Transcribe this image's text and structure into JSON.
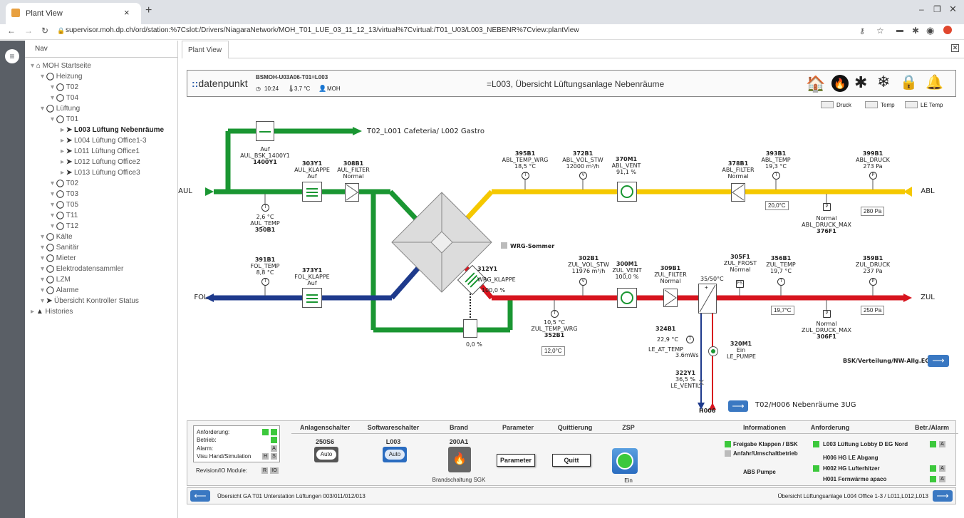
{
  "browser": {
    "tab_title": "Plant View",
    "url": "supervisor.moh.dp.ch/ord/station:%7Cslot:/Drivers/NiagaraNetwork/MOH_T01_LUE_03_11_12_13/virtual%7Cvirtual:/T01_U03/L003_NEBENR%7Cview:plantView"
  },
  "nav": {
    "title": "Nav",
    "items": [
      {
        "label": "MOH Startseite",
        "lvl": 0,
        "icon": "home"
      },
      {
        "label": "Heizung",
        "lvl": 1,
        "icon": "circle"
      },
      {
        "label": "T02",
        "lvl": 2,
        "icon": "circle"
      },
      {
        "label": "T04",
        "lvl": 2,
        "icon": "circle"
      },
      {
        "label": "Lüftung",
        "lvl": 1,
        "icon": "circle"
      },
      {
        "label": "T01",
        "lvl": 2,
        "icon": "circle"
      },
      {
        "label": "L003 Lüftung Nebenräume",
        "lvl": 3,
        "icon": "arrow",
        "sel": true
      },
      {
        "label": "L004 Lüftung Office1-3",
        "lvl": 3,
        "icon": "arrow"
      },
      {
        "label": "L011 Lüftung Office1",
        "lvl": 3,
        "icon": "arrow"
      },
      {
        "label": "L012 Lüftung Office2",
        "lvl": 3,
        "icon": "arrow"
      },
      {
        "label": "L013 Lüftung Office3",
        "lvl": 3,
        "icon": "arrow"
      },
      {
        "label": "T02",
        "lvl": 2,
        "icon": "circle"
      },
      {
        "label": "T03",
        "lvl": 2,
        "icon": "circle"
      },
      {
        "label": "T05",
        "lvl": 2,
        "icon": "circle"
      },
      {
        "label": "T11",
        "lvl": 2,
        "icon": "circle"
      },
      {
        "label": "T12",
        "lvl": 2,
        "icon": "circle"
      },
      {
        "label": "Kälte",
        "lvl": 1,
        "icon": "circle"
      },
      {
        "label": "Sanitär",
        "lvl": 1,
        "icon": "circle"
      },
      {
        "label": "Mieter",
        "lvl": 1,
        "icon": "circle"
      },
      {
        "label": "Elektrodatensammler",
        "lvl": 1,
        "icon": "circle"
      },
      {
        "label": "LZM",
        "lvl": 1,
        "icon": "circle"
      },
      {
        "label": "Alarme",
        "lvl": 1,
        "icon": "circle"
      },
      {
        "label": "Übersicht Kontroller Status",
        "lvl": 1,
        "icon": "arrow"
      },
      {
        "label": "Histories",
        "lvl": 0,
        "icon": "warn"
      }
    ]
  },
  "pv": {
    "tab": "Plant View"
  },
  "header": {
    "logo": "datenpunkt",
    "id": "BSMOH-U03A06-T01=L003",
    "time": "10:24",
    "temp": "3,7 °C",
    "user": "MOH",
    "title": "=L003, Übersicht Lüftungsanlage Nebenräume"
  },
  "legend": {
    "druck": "Druck",
    "temp": "Temp",
    "letemp": "LE Temp"
  },
  "plant": {
    "aul": "AUL",
    "abl": "ABL",
    "fol": "FOL",
    "zul": "ZUL",
    "cafeteria": "T02_L001 Cafeteria/ L002 Gastro",
    "bsk_auf": "Auf",
    "bsk_code": "AUL_BSK_1400Y1",
    "bsk_id": "1400Y1",
    "y303_id": "303Y1",
    "y303_name": "AUL_KLAPPE",
    "y303_state": "Auf",
    "b308_id": "308B1",
    "b308_name": "AUL_FILTER",
    "b308_state": "Normal",
    "b350_val": "2,6 °C",
    "b350_name": "AUL_TEMP",
    "b350_id": "350B1",
    "b395_id": "395B1",
    "b395_name": "ABL_TEMP_WRG",
    "b395_val": "18,5 °C",
    "b372_id": "372B1",
    "b372_name": "ABL_VOL_STW",
    "b372_val": "12000 m³/h",
    "m370_id": "370M1",
    "m370_name": "ABL_VENT",
    "m370_val": "91,1 %",
    "b378_id": "378B1",
    "b378_name": "ABL_FILTER",
    "b378_state": "Normal",
    "b393_id": "393B1",
    "b393_name": "ABL_TEMP",
    "b393_val": "19,3 °C",
    "b393_box": "20,0°C",
    "b399_id": "399B1",
    "b399_name": "ABL_DRUCK",
    "b399_val": "273 Pa",
    "b399_box": "280 Pa",
    "f376_state": "Normal",
    "f376_name": "ABL_DRUCK_MAX",
    "f376_id": "376F1",
    "wrg_sommer": "WRG-Sommer",
    "b391_id": "391B1",
    "b391_name": "FOL_TEMP",
    "b391_val": "8,8 °C",
    "y373_id": "373Y1",
    "y373_name": "FOL_KLAPPE",
    "y373_state": "Auf",
    "y312_id": "312Y1",
    "y312_name": "WRG_KLAPPE",
    "y312_val": "100,0 %",
    "bypass_val": "0,0 %",
    "b302_id": "302B1",
    "b302_name": "ZUL_VOL_STW",
    "b302_val": "11976 m³/h",
    "m300_id": "300M1",
    "m300_name": "ZUL_VENT",
    "m300_val": "100,0 %",
    "b309_id": "309B1",
    "b309_name": "ZUL_FILTER",
    "b309_state": "Normal",
    "f305_id": "305F1",
    "f305_name": "ZUL_FROST",
    "f305_state": "Normal",
    "b356_id": "356B1",
    "b356_name": "ZUL_TEMP",
    "b356_val": "19,7 °C",
    "b356_box": "19,7°C",
    "b359_id": "359B1",
    "b359_name": "ZUL_DRUCK",
    "b359_val": "237 Pa",
    "b359_box": "250 Pa",
    "f306_state": "Normal",
    "f306_name": "ZUL_DRUCK_MAX",
    "f306_id": "306F1",
    "b352_val": "10,5 °C",
    "b352_name": "ZUL_TEMP_WRG",
    "b352_id": "352B1",
    "b352_box": "12,0°C",
    "coil_label": "35/50°C",
    "b324_id": "324B1",
    "b324_val": "22,9 °C",
    "b324_name": "LE_AT_TEMP",
    "b324_pres": "3.6mWs",
    "m320_id": "320M1",
    "m320_state": "Ein",
    "m320_name": "LE_PUMPE",
    "y322_id": "322Y1",
    "y322_val": "36,5 %",
    "y322_name": "LE_VENTIL",
    "h006": "H006",
    "h006_link": "T02/H006 Nebenräume 3UG",
    "bsk_link": "BSK/Verteilung/NW-Allg.EG."
  },
  "status": {
    "anf": "Anforderung:",
    "betrieb": "Betrieb:",
    "alarm": "Alarm:",
    "visu": "Visu Hand/Simulation",
    "rev": "Revision/IO Module:",
    "a": "A",
    "h": "H",
    "s": "S",
    "r": "R",
    "io": "IO"
  },
  "cols": {
    "anlagen": "Anlagenschalter",
    "software": "Softwareschalter",
    "brand": "Brand",
    "param": "Parameter",
    "quitt": "Quittierung",
    "zsp": "ZSP",
    "info": "Informationen",
    "anford": "Anforderung",
    "betr": "Betr./Alarm"
  },
  "ctrl": {
    "s1_id": "250S6",
    "s1_btn": "Auto",
    "s2_id": "L003",
    "s2_btn": "Auto",
    "brand_id": "200A1",
    "brand_txt": "Brandschaltung SGK",
    "param_btn": "Parameter",
    "quitt_btn": "Quitt",
    "zsp_state": "Ein"
  },
  "info": {
    "i1": "Freigabe Klappen / BSK",
    "i2": "Anfahr/Umschaltbetrieb",
    "i3": "ABS Pumpe"
  },
  "anf": {
    "a1": "L003 Lüftung Lobby D EG Nord",
    "a2": "H006 HG LE Abgang",
    "a3": "H002 HG Lufterhitzer",
    "a4": "H001 Fernwärme apaco"
  },
  "footer": {
    "left": "Übersicht GA T01 Unterstation Lüftungen 003/011/012/013",
    "right": "Übersicht Lüftungsanlage L004 Office 1-3 / L011,L012,L013"
  },
  "colors": {
    "aul": "#1a9632",
    "abl": "#f5c800",
    "fol": "#1e3a8c",
    "zul": "#d7141e"
  }
}
